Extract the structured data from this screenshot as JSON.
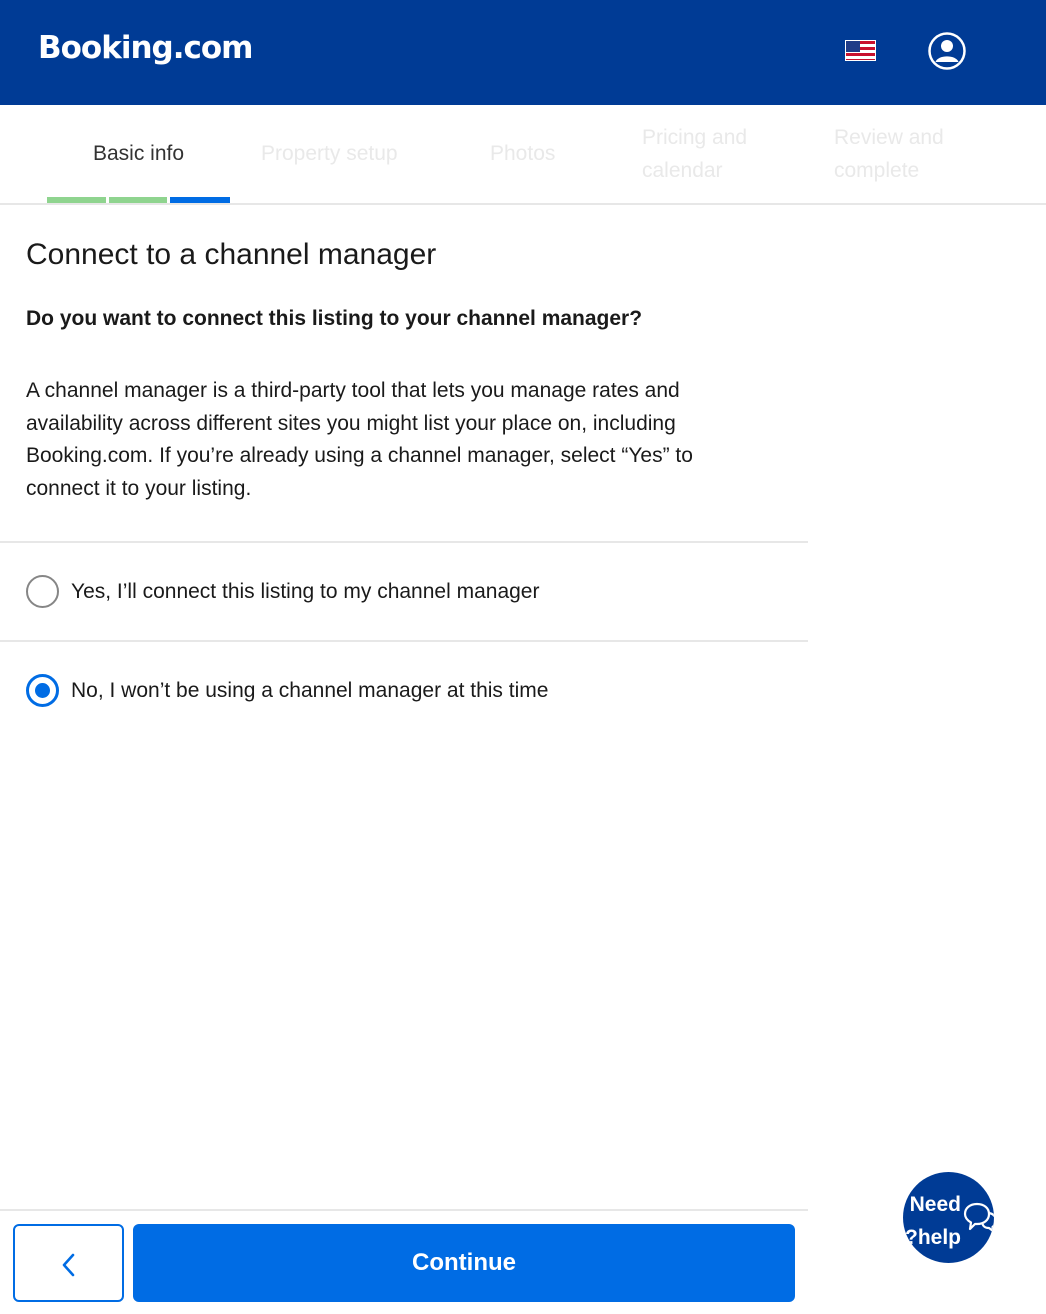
{
  "header": {
    "logo": "Booking.com",
    "flag_icon": "us-flag-icon",
    "account_icon": "account-icon"
  },
  "steps": [
    {
      "line1": "Basic info",
      "line2": "",
      "state": "active"
    },
    {
      "line1": "Property setup",
      "line2": "",
      "state": "upcoming"
    },
    {
      "line1": "Photos",
      "line2": "",
      "state": "upcoming"
    },
    {
      "line1": "Pricing and",
      "line2": "calendar",
      "state": "upcoming"
    },
    {
      "line1": "Review and",
      "line2": "complete",
      "state": "upcoming"
    }
  ],
  "progress": {
    "done_color": "#8fd48f",
    "current_color": "#006ce4"
  },
  "main": {
    "title": "Connect to a channel manager",
    "question": "Do you want to connect this listing to your channel manager?",
    "description": "A channel manager is a third-party tool that lets you manage rates and availability across different sites you might list your place on, including Booking.com. If you’re already using a channel manager, select “Yes” to connect it to your listing.",
    "options": [
      {
        "label": "Yes, I’ll connect this listing to my channel manager",
        "selected": false
      },
      {
        "label": "No, I won’t be using a channel manager at this time",
        "selected": true
      }
    ]
  },
  "footer": {
    "back_icon": "chevron-left-icon",
    "continue_label": "Continue"
  },
  "help": {
    "line1": "Need",
    "line2": "help?",
    "icon": "chat-bubble-icon"
  },
  "colors": {
    "brand_dark": "#003b95",
    "brand_blue": "#006ce4"
  }
}
